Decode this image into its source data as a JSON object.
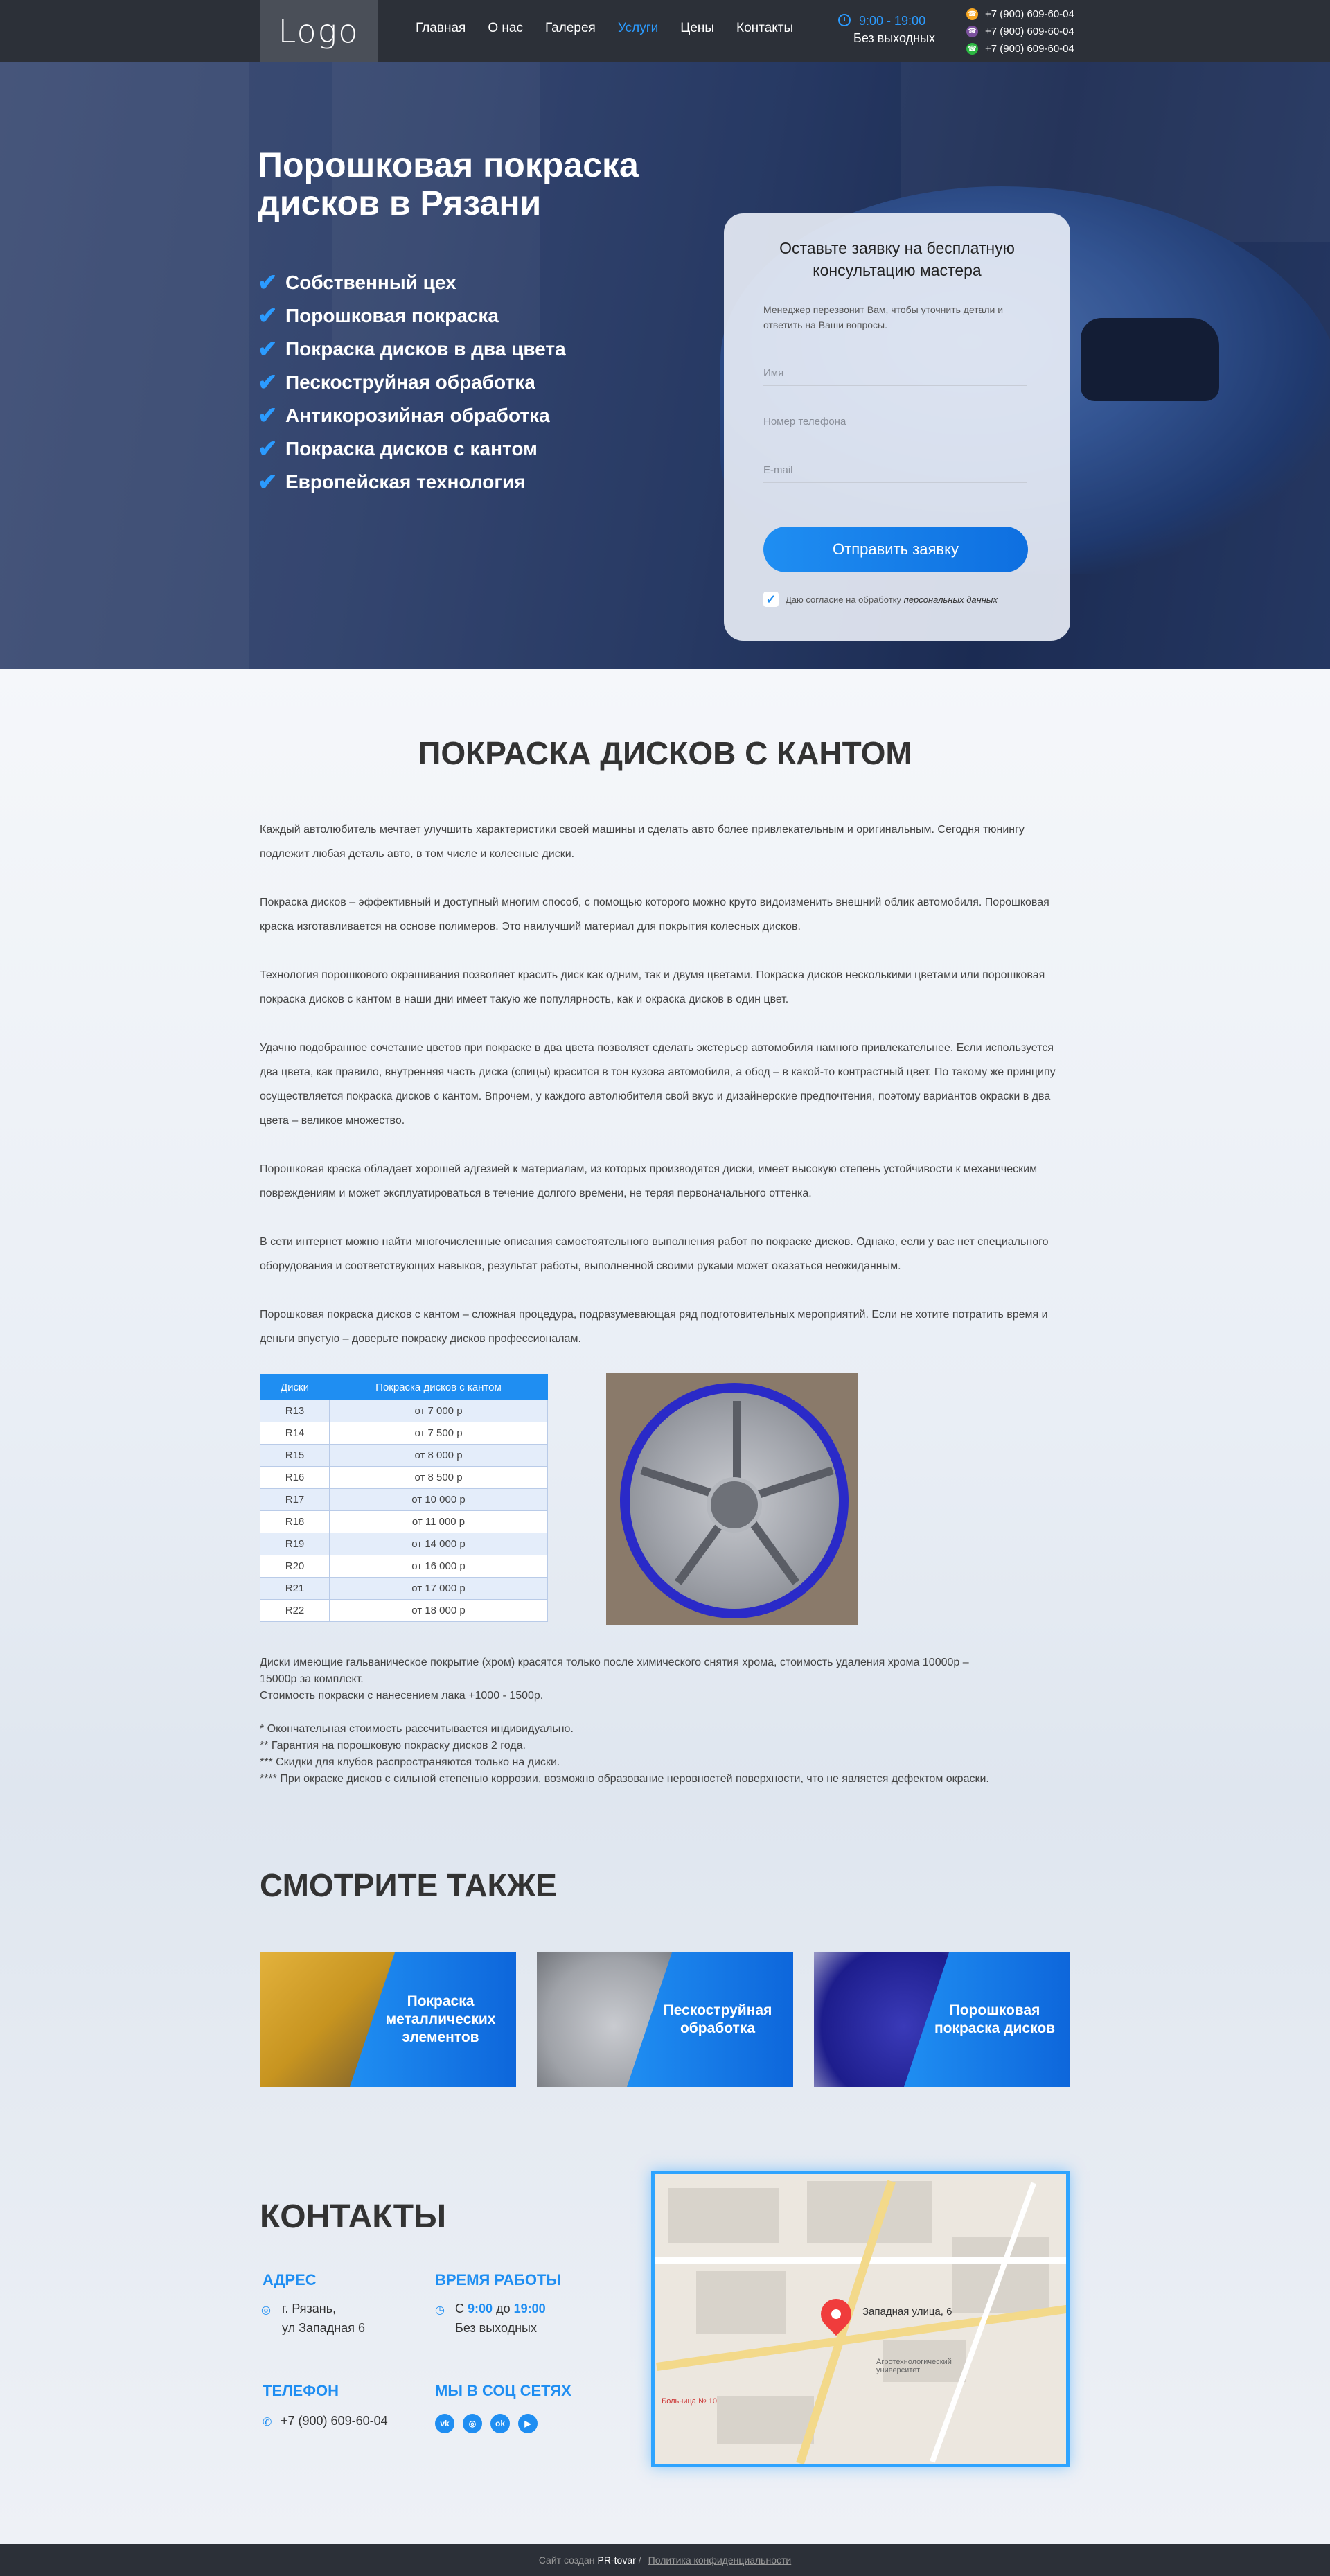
{
  "header": {
    "logo": "Logo",
    "nav": [
      "Главная",
      "О нас",
      "Галерея",
      "Услуги",
      "Цены",
      "Контакты"
    ],
    "hours_time": "9:00 - 19:00",
    "hours_days": "Без выходных",
    "phones": [
      "+7 (900) 609-60-04",
      "+7 (900) 609-60-04",
      "+7 (900) 609-60-04"
    ]
  },
  "hero": {
    "title": "Порошковая покраска дисков в Рязани",
    "features": [
      "Собственный цех",
      "Порошковая покраска",
      "Покраска дисков в два цвета",
      "Пескоструйная обработка",
      "Антикорозийная обработка",
      "Покраска дисков с кантом",
      "Европейская технология"
    ]
  },
  "form": {
    "title": "Оставьте заявку на бесплатную консультацию мастера",
    "subtitle": "Менеджер перезвонит Вам, чтобы уточнить детали и ответить на Ваши вопросы.",
    "name_placeholder": "Имя",
    "phone_placeholder": "Номер телефона",
    "email_placeholder": "E-mail",
    "submit": "Отправить заявку",
    "consent_text": "Даю согласие на обработку",
    "consent_link": "персональных данных"
  },
  "article": {
    "title": "ПОКРАСКА ДИСКОВ С КАНТОМ",
    "paragraphs": [
      "Каждый автолюбитель мечтает улучшить характеристики своей машины и сделать авто более привлекательным и оригинальным. Сегодня тюнингу подлежит любая деталь авто, в том числе и колесные диски.",
      "Покраска дисков – эффективный и доступный многим способ, с помощью которого можно круто видоизменить внешний облик автомобиля. Порошковая краска изготавливается на основе полимеров. Это наилучший материал для покрытия колесных дисков.",
      "Технология порошкового окрашивания позволяет красить диск как одним, так и двумя цветами. Покраска дисков несколькими цветами или порошковая покраска дисков с кантом в наши дни имеет такую же популярность, как и окраска дисков в один цвет.",
      "Удачно подобранное сочетание цветов при покраске в два цвета позволяет сделать экстерьер автомобиля намного привлекательнее. Если используется два цвета, как правило, внутренняя часть диска (спицы) красится в тон кузова автомобиля, а обод – в какой-то контрастный цвет. По такому же принципу осуществляется покраска дисков с кантом. Впрочем, у каждого автолюбителя свой вкус и дизайнерские предпочтения, поэтому вариантов окраски в два цвета – великое множество.",
      "Порошковая краска обладает хорошей адгезией к материалам, из которых производятся диски, имеет высокую степень устойчивости к механическим повреждениям и может эксплуатироваться в течение долгого времени, не теряя первоначального оттенка.",
      "В сети интернет можно найти многочисленные описания самостоятельного выполнения работ по покраске дисков. Однако, если у вас нет специального оборудования и соответствующих навыков, результат работы, выполненной своими руками может оказаться неожиданным.",
      "Порошковая покраска дисков с кантом – сложная процедура, подразумевающая ряд подготовительных мероприятий. Если не хотите потратить время и деньги впустую – доверьте покраску дисков профессионалам."
    ]
  },
  "price_table": {
    "headers": [
      "Диски",
      "Покраска дисков с кантом"
    ],
    "rows": [
      [
        "R13",
        "от 7 000 р"
      ],
      [
        "R14",
        "от 7 500 р"
      ],
      [
        "R15",
        "от 8 000 р"
      ],
      [
        "R16",
        "от 8 500 р"
      ],
      [
        "R17",
        "от 10 000 р"
      ],
      [
        "R18",
        "от 11 000 р"
      ],
      [
        "R19",
        "от 14 000 р"
      ],
      [
        "R20",
        "от 16 000 р"
      ],
      [
        "R21",
        "от 17 000 р"
      ],
      [
        "R22",
        "от 18 000 р"
      ]
    ]
  },
  "notes": {
    "chrome": "Диски имеющие гальваническое покрытие (хром) красятся только после химического снятия хрома, стоимость удаления хрома 10000р – 15000р за комплект.\nСтоимость покраски с нанесением лака +1000 - 1500р.",
    "footnotes": "* Окончательная стоимость рассчитывается индивидуально.\n** Гарантия на порошковую покраску дисков 2 года.\n*** Скидки для клубов распространяются только на диски.\n**** При окраске дисков с сильной степенью коррозии,  возможно образование неровностей поверхности, что не является дефектом окраски."
  },
  "see_also": {
    "title": "СМОТРИТЕ ТАКЖЕ",
    "cards": [
      "Покраска металлических элементов",
      "Пескоструйная обработка",
      "Порошковая покраска дисков"
    ]
  },
  "contacts": {
    "title": "КОНТАКТЫ",
    "address_title": "АДРЕС",
    "address": "г. Рязань,\nул Западная 6",
    "hours_title": "ВРЕМЯ РАБОТЫ",
    "hours_prefix": "С",
    "hours_from": "9:00",
    "hours_mid": "до",
    "hours_to": "19:00",
    "hours_days": "Без выходных",
    "phone_title": "ТЕЛЕФОН",
    "phone": "+7 (900) 609-60-04",
    "social_title": "МЫ В СОЦ СЕТЯХ",
    "social": [
      "vk",
      "ig",
      "ok",
      "yt"
    ]
  },
  "map": {
    "label": "Западная улица, 6",
    "poi": "Агротехнологический университет",
    "hospital": "Больница № 10"
  },
  "footer": {
    "created": "Сайт создан",
    "brand": "PR-tovar",
    "sep": "/",
    "policy": "Политика конфиденциальности"
  },
  "colors": {
    "accent": "#1f8ef2",
    "header": "#2c3038"
  }
}
